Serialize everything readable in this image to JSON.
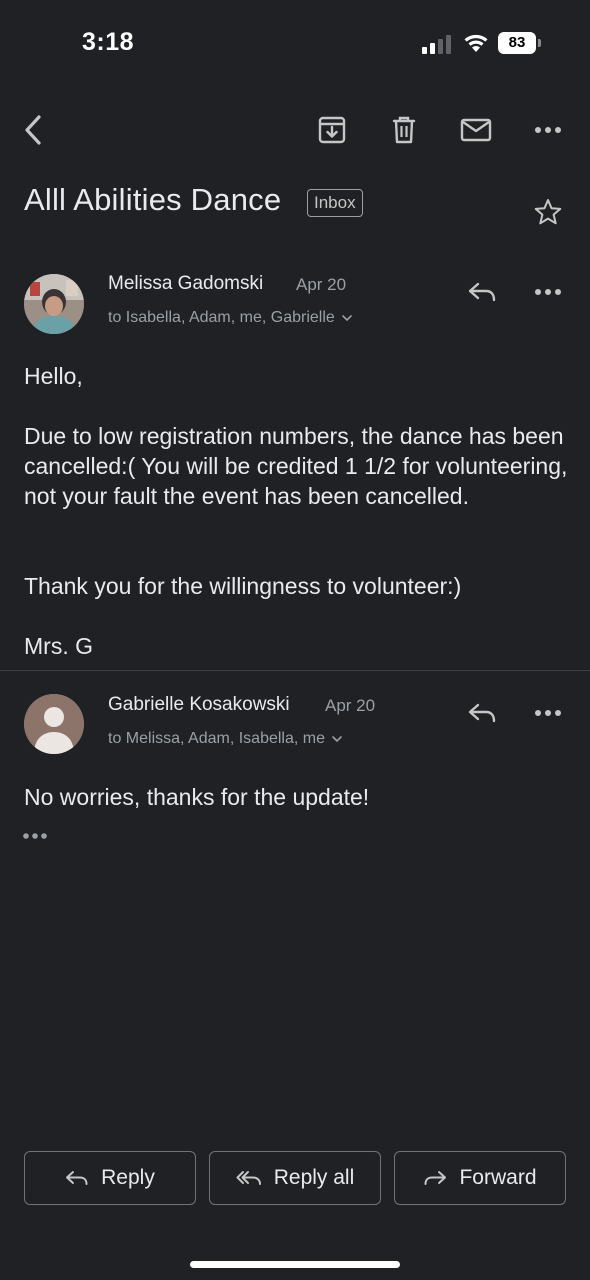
{
  "status_bar": {
    "time": "3:18",
    "battery": "83"
  },
  "toolbar": {
    "back_icon": "chevron-left-icon",
    "archive_icon": "archive-icon",
    "delete_icon": "trash-icon",
    "mail_icon": "mail-icon",
    "more_icon": "more-horizontal-icon"
  },
  "email": {
    "subject": "Alll Abilities Dance",
    "label": "Inbox"
  },
  "messages": [
    {
      "sender": "Melissa Gadomski",
      "date": "Apr 20",
      "recipients": "to Isabella, Adam, me, Gabrielle",
      "body": [
        "Hello,",
        "Due to low registration numbers, the dance has been cancelled:(  You will be credited 1 1/2 for volunteering, not your fault the event has been cancelled.",
        "Thank you for the willingness to volunteer:)",
        "Mrs. G"
      ]
    },
    {
      "sender": "Gabrielle Kosakowski",
      "date": "Apr 20",
      "recipients": "to Melissa, Adam, Isabella, me",
      "body": [
        "No worries, thanks for the update!"
      ]
    }
  ],
  "actions": {
    "reply": "Reply",
    "reply_all": "Reply all",
    "forward": "Forward"
  },
  "colors": {
    "background": "#202124",
    "text": "#e8eaed",
    "secondary_text": "#9aa0a6"
  }
}
